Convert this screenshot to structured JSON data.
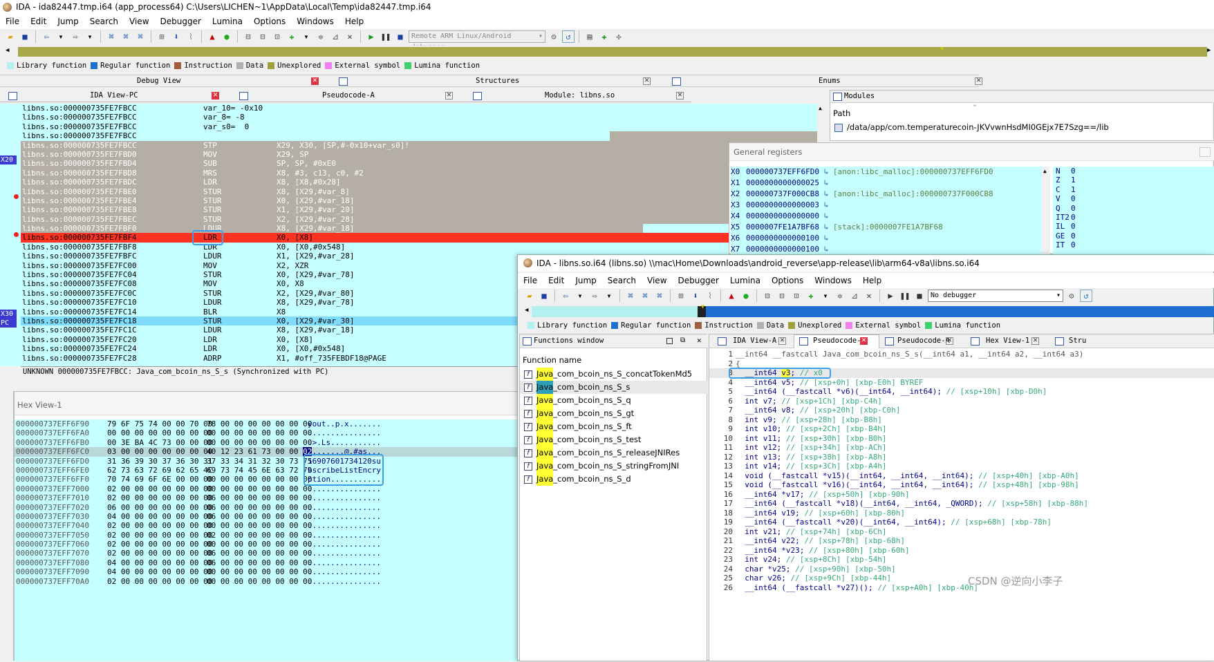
{
  "main": {
    "title": "IDA - ida82447.tmp.i64 (app_process64) C:\\Users\\LICHEN~1\\AppData\\Local\\Temp\\ida82447.tmp.i64",
    "menu": [
      "File",
      "Edit",
      "Jump",
      "Search",
      "View",
      "Debugger",
      "Lumina",
      "Options",
      "Windows",
      "Help"
    ],
    "debugger_select": "Remote ARM Linux/Android debugger",
    "legend": [
      {
        "label": "Library function",
        "color": "#b3f0f0"
      },
      {
        "label": "Regular function",
        "color": "#1f6fd0"
      },
      {
        "label": "Instruction",
        "color": "#a06040"
      },
      {
        "label": "Data",
        "color": "#b0b0b0"
      },
      {
        "label": "Unexplored",
        "color": "#a0a040"
      },
      {
        "label": "External symbol",
        "color": "#f080f0"
      },
      {
        "label": "Lumina function",
        "color": "#40d070"
      }
    ],
    "panel_tabs": {
      "debug_view": "Debug View",
      "structures": "Structures",
      "enums": "Enums"
    },
    "subtabs": {
      "ida_view": "IDA View-PC",
      "pseudocode": "Pseudocode-A",
      "module": "Module: libns.so"
    },
    "reg_labels": {
      "x20": "X20",
      "x30": "X30",
      "pc": "PC"
    },
    "asm_lines": [
      {
        "addr": "libns.so:000000735FE7FBCC",
        "text": "var_10= -0x10",
        "style": "n"
      },
      {
        "addr": "libns.so:000000735FE7FBCC",
        "text": "var_8= -8",
        "style": "n"
      },
      {
        "addr": "libns.so:000000735FE7FBCC",
        "text": "var_s0=  0",
        "style": "n"
      },
      {
        "addr": "libns.so:000000735FE7FBCC",
        "text": "",
        "style": "sep"
      },
      {
        "addr": "libns.so:000000735FE7FBCC",
        "text": "STP             X29, X30, [SP,#-0x10+var_s0]!",
        "style": "g"
      },
      {
        "addr": "libns.so:000000735FE7FBD0",
        "text": "MOV             X29, SP",
        "style": "g"
      },
      {
        "addr": "libns.so:000000735FE7FBD4",
        "text": "SUB             SP, SP, #0xE0",
        "style": "g"
      },
      {
        "addr": "libns.so:000000735FE7FBD8",
        "text": "MRS             X8, #3, c13, c0, #2",
        "style": "g"
      },
      {
        "addr": "libns.so:000000735FE7FBDC",
        "text": "LDR             X8, [X8,#0x28]",
        "style": "g"
      },
      {
        "addr": "libns.so:000000735FE7FBE0",
        "text": "STUR            X8, [X29,#var_8]",
        "style": "g"
      },
      {
        "addr": "libns.so:000000735FE7FBE4",
        "text": "STUR            X0, [X29,#var_18]",
        "style": "g"
      },
      {
        "addr": "libns.so:000000735FE7FBE8",
        "text": "STUR            X1, [X29,#var_20]",
        "style": "g"
      },
      {
        "addr": "libns.so:000000735FE7FBEC",
        "text": "STUR            X2, [X29,#var_28]",
        "style": "g"
      },
      {
        "addr": "libns.so:000000735FE7FBF0",
        "text": "LDUR            X8, [X29,#var_18]",
        "style": "g2"
      },
      {
        "addr": "libns.so:000000735FE7FBF4",
        "text": "LDR             X0, [X8]",
        "style": "r"
      },
      {
        "addr": "libns.so:000000735FE7FBF8",
        "text": "LDR             X0, [X0,#0x548]",
        "style": "n"
      },
      {
        "addr": "libns.so:000000735FE7FBFC",
        "text": "LDUR            X1, [X29,#var_28]",
        "style": "n"
      },
      {
        "addr": "libns.so:000000735FE7FC00",
        "text": "MOV             X2, XZR",
        "style": "n"
      },
      {
        "addr": "libns.so:000000735FE7FC04",
        "text": "STUR            X0, [X29,#var_78]",
        "style": "n"
      },
      {
        "addr": "libns.so:000000735FE7FC08",
        "text": "MOV             X0, X8",
        "style": "n"
      },
      {
        "addr": "libns.so:000000735FE7FC0C",
        "text": "STUR            X2, [X29,#var_80]",
        "style": "n"
      },
      {
        "addr": "libns.so:000000735FE7FC10",
        "text": "LDUR            X8, [X29,#var_78]",
        "style": "n"
      },
      {
        "addr": "libns.so:000000735FE7FC14",
        "text": "BLR             X8",
        "style": "n"
      },
      {
        "addr": "libns.so:000000735FE7FC18",
        "text": "STUR            X0, [X29,#var_30]",
        "style": "b"
      },
      {
        "addr": "libns.so:000000735FE7FC1C",
        "text": "LDUR            X8, [X29,#var_18]",
        "style": "n"
      },
      {
        "addr": "libns.so:000000735FE7FC20",
        "text": "LDR             X0, [X8]",
        "style": "n"
      },
      {
        "addr": "libns.so:000000735FE7FC24",
        "text": "LDR             X0, [X0,#0x548]",
        "style": "n"
      },
      {
        "addr": "libns.so:000000735FE7FC28",
        "text": "ADRP            X1, #off_735FEBDF18@PAGE",
        "style": "n"
      }
    ],
    "asm_status": "UNKNOWN 000000735FE7FBCC: Java_com_bcoin_ns_S_s (Synchronized with PC)",
    "modules_title": "Modules",
    "modules_path_header": "Path",
    "modules_path": "/data/app/com.temperaturecoin-JKVvwnHsdMI0GEjx7E7Szg==/lib",
    "registers_title": "General registers",
    "registers": [
      {
        "name": "X0",
        "value": "000000737EFF6FD0",
        "ref": "[anon:libc_malloc]:000000737EFF6FD0"
      },
      {
        "name": "X1",
        "value": "0000000000000025",
        "ref": ""
      },
      {
        "name": "X2",
        "value": "000000737F000CB8",
        "ref": "[anon:libc_malloc]:000000737F000CB8"
      },
      {
        "name": "X3",
        "value": "0000000000000003",
        "ref": ""
      },
      {
        "name": "X4",
        "value": "0000000000000000",
        "ref": ""
      },
      {
        "name": "X5",
        "value": "0000007FE1A7BF68",
        "ref": "[stack]:0000007FE1A7BF68"
      },
      {
        "name": "X6",
        "value": "0000000000000100",
        "ref": ""
      },
      {
        "name": "X7",
        "value": "0000000000000100",
        "ref": ""
      }
    ],
    "flags": [
      {
        "n": "N",
        "v": "0"
      },
      {
        "n": "Z",
        "v": "1"
      },
      {
        "n": "C",
        "v": "1"
      },
      {
        "n": "V",
        "v": "0"
      },
      {
        "n": "Q",
        "v": "0"
      },
      {
        "n": "IT2",
        "v": "0"
      },
      {
        "n": "IL",
        "v": "0"
      },
      {
        "n": "GE",
        "v": "0"
      },
      {
        "n": "IT",
        "v": "0"
      }
    ],
    "hex_title": "Hex View-1",
    "hex_rows": [
      {
        "addr": "000000737EFF6F90",
        "b1": "79 6F 75 74 00 00 70 00",
        "b2": "78 00 00 00 00 00 00 00",
        "ascii": "yout..p.x......."
      },
      {
        "addr": "000000737EFF6FA0",
        "b1": "00 00 00 00 00 00 00 00",
        "b2": "00 00 00 00 00 00 00 00",
        "ascii": "................"
      },
      {
        "addr": "000000737EFF6FB0",
        "b1": "00 3E BA 4C 73 00 00 00",
        "b2": "00 00 00 00 00 00 00 00",
        "ascii": ".>.Ls..........."
      },
      {
        "addr": "000000737EFF6FC0",
        "b1": "03 00 00 00 00 00 00 00",
        "b2": "40 12 23 61 73 00 00 02",
        "ascii": "........@.#as..."
      },
      {
        "addr": "000000737EFF6FD0",
        "b1": "31 36 39 30 37 36 30 31",
        "b2": "37 33 34 31 32 30 73 75",
        "ascii": "16907601734120su"
      },
      {
        "addr": "000000737EFF6FE0",
        "b1": "62 73 63 72 69 62 65 4C",
        "b2": "69 73 74 45 6E 63 72 79",
        "ascii": "bscribeListEncry"
      },
      {
        "addr": "000000737EFF6FF0",
        "b1": "70 74 69 6F 6E 00 00 00",
        "b2": "00 00 00 00 00 00 00 00",
        "ascii": "ption..........."
      },
      {
        "addr": "000000737EFF7000",
        "b1": "02 00 00 00 00 00 00 00",
        "b2": "00 00 00 00 00 00 00 00",
        "ascii": "................"
      },
      {
        "addr": "000000737EFF7010",
        "b1": "02 00 00 00 00 00 00 00",
        "b2": "06 00 00 00 00 00 00 00",
        "ascii": "................"
      },
      {
        "addr": "000000737EFF7020",
        "b1": "06 00 00 00 00 00 00 00",
        "b2": "06 00 00 00 00 00 00 00",
        "ascii": "................"
      },
      {
        "addr": "000000737EFF7030",
        "b1": "04 00 00 00 00 00 00 00",
        "b2": "06 00 00 00 00 00 00 00",
        "ascii": "................"
      },
      {
        "addr": "000000737EFF7040",
        "b1": "02 00 00 00 00 00 00 00",
        "b2": "00 00 00 00 00 00 00 00",
        "ascii": "................"
      },
      {
        "addr": "000000737EFF7050",
        "b1": "02 00 00 00 00 00 00 00",
        "b2": "02 00 00 00 00 00 00 00",
        "ascii": "................"
      },
      {
        "addr": "000000737EFF7060",
        "b1": "02 00 00 00 00 00 00 00",
        "b2": "00 00 00 00 00 00 00 00",
        "ascii": "................"
      },
      {
        "addr": "000000737EFF7070",
        "b1": "02 00 00 00 00 00 00 00",
        "b2": "06 00 00 00 00 00 00 00",
        "ascii": "................"
      },
      {
        "addr": "000000737EFF7080",
        "b1": "04 00 00 00 00 00 00 00",
        "b2": "06 00 00 00 00 00 00 00",
        "ascii": "................"
      },
      {
        "addr": "000000737EFF7090",
        "b1": "04 00 00 00 00 00 00 00",
        "b2": "00 00 00 00 00 00 00 00",
        "ascii": "................"
      },
      {
        "addr": "000000737EFF70A0",
        "b1": "02 00 00 00 00 00 00 00",
        "b2": "00 00 00 00 00 00 00 00",
        "ascii": "................"
      }
    ]
  },
  "second": {
    "title": "IDA - libns.so.i64 (libns.so) \\\\mac\\Home\\Downloads\\android_reverse\\app-release\\lib\\arm64-v8a\\libns.so.i64",
    "menu": [
      "File",
      "Edit",
      "Jump",
      "Search",
      "View",
      "Debugger",
      "Lumina",
      "Options",
      "Windows",
      "Help"
    ],
    "debugger_select": "No debugger",
    "functions_title": "Functions window",
    "functions_header": "Function name",
    "functions": [
      {
        "hl": "Java",
        "rest": "_com_bcoin_ns_S_concatTokenMd5"
      },
      {
        "hl": "Java",
        "rest": "_com_bcoin_ns_S_s"
      },
      {
        "hl": "Java",
        "rest": "_com_bcoin_ns_S_q"
      },
      {
        "hl": "Java",
        "rest": "_com_bcoin_ns_S_gt"
      },
      {
        "hl": "Java",
        "rest": "_com_bcoin_ns_S_ft"
      },
      {
        "hl": "Java",
        "rest": "_com_bcoin_ns_S_test"
      },
      {
        "hl": "Java",
        "rest": "_com_bcoin_ns_S_releaseJNIRes"
      },
      {
        "hl": "Java",
        "rest": "_com_bcoin_ns_S_stringFromJNI"
      },
      {
        "hl": "Java",
        "rest": "_com_bcoin_ns_S_d"
      }
    ],
    "tabs": [
      "IDA View-A",
      "Pseudocode-B",
      "Pseudocode-A",
      "Hex View-1",
      "Stru"
    ],
    "code": [
      {
        "n": "1",
        "c": "__int64 __fastcall Java_com_bcoin_ns_S_s(__int64 a1, __int64 a2, __int64 a3)",
        "cm": ""
      },
      {
        "n": "2",
        "c": "{",
        "cm": ""
      },
      {
        "n": "3",
        "c": "  __int64 v3; ",
        "cm": "// x0"
      },
      {
        "n": "4",
        "c": "  __int64 v5; ",
        "cm": "// [xsp+0h] [xbp-E0h] BYREF"
      },
      {
        "n": "5",
        "c": "  __int64 (__fastcall *v6)(__int64, __int64); ",
        "cm": "// [xsp+10h] [xbp-D0h]"
      },
      {
        "n": "6",
        "c": "  int v7; ",
        "cm": "// [xsp+1Ch] [xbp-C4h]"
      },
      {
        "n": "7",
        "c": "  __int64 v8; ",
        "cm": "// [xsp+20h] [xbp-C0h]"
      },
      {
        "n": "8",
        "c": "  int v9; ",
        "cm": "// [xsp+28h] [xbp-B8h]"
      },
      {
        "n": "9",
        "c": "  int v10; ",
        "cm": "// [xsp+2Ch] [xbp-B4h]"
      },
      {
        "n": "10",
        "c": "  int v11; ",
        "cm": "// [xsp+30h] [xbp-B0h]"
      },
      {
        "n": "11",
        "c": "  int v12; ",
        "cm": "// [xsp+34h] [xbp-ACh]"
      },
      {
        "n": "12",
        "c": "  int v13; ",
        "cm": "// [xsp+38h] [xbp-A8h]"
      },
      {
        "n": "13",
        "c": "  int v14; ",
        "cm": "// [xsp+3Ch] [xbp-A4h]"
      },
      {
        "n": "14",
        "c": "  void (__fastcall *v15)(__int64, __int64, __int64); ",
        "cm": "// [xsp+40h] [xbp-A0h]"
      },
      {
        "n": "15",
        "c": "  void (__fastcall *v16)(__int64, __int64, __int64); ",
        "cm": "// [xsp+48h] [xbp-98h]"
      },
      {
        "n": "16",
        "c": "  __int64 *v17; ",
        "cm": "// [xsp+50h] [xbp-90h]"
      },
      {
        "n": "17",
        "c": "  __int64 (__fastcall *v18)(__int64, __int64, _QWORD); ",
        "cm": "// [xsp+58h] [xbp-88h]"
      },
      {
        "n": "18",
        "c": "  __int64 v19; ",
        "cm": "// [xsp+60h] [xbp-80h]"
      },
      {
        "n": "19",
        "c": "  __int64 (__fastcall *v20)(__int64, __int64); ",
        "cm": "// [xsp+68h] [xbp-78h]"
      },
      {
        "n": "20",
        "c": "  int v21; ",
        "cm": "// [xsp+74h] [xbp-6Ch]"
      },
      {
        "n": "21",
        "c": "  __int64 v22; ",
        "cm": "// [xsp+78h] [xbp-68h]"
      },
      {
        "n": "22",
        "c": "  __int64 *v23; ",
        "cm": "// [xsp+80h] [xbp-60h]"
      },
      {
        "n": "23",
        "c": "  int v24; ",
        "cm": "// [xsp+8Ch] [xbp-54h]"
      },
      {
        "n": "24",
        "c": "  char *v25; ",
        "cm": "// [xsp+90h] [xbp-50h]"
      },
      {
        "n": "25",
        "c": "  char v26; ",
        "cm": "// [xsp+9Ch] [xbp-44h]"
      },
      {
        "n": "26",
        "c": "  __int64 (__fastcall *v27)(); ",
        "cm": "// [xsp+A0h] [xbp-40h]"
      }
    ]
  },
  "watermark": "CSDN @逆向小李子"
}
